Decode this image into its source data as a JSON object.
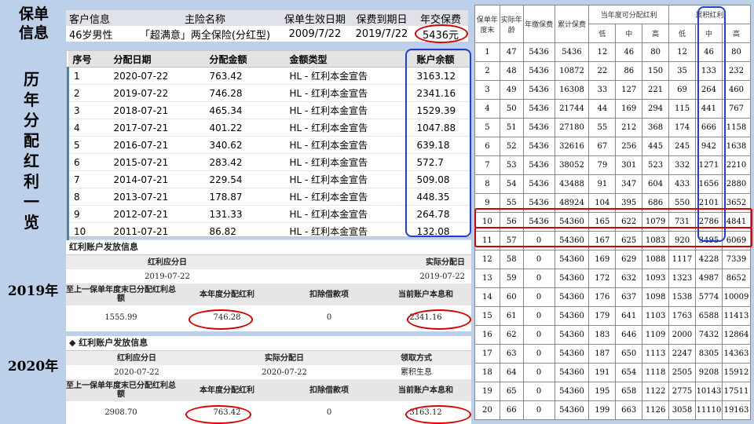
{
  "labels": {
    "policy_info": "保单信息",
    "history": "历年分配红利一览",
    "year_2019": "2019年",
    "year_2020": "2020年"
  },
  "policy": {
    "headers": [
      "客户信息",
      "主险名称",
      "保单生效日期",
      "保费到期日",
      "年交保费"
    ],
    "values": [
      "46岁男性",
      "「超满意」两全保险(分红型)",
      "2009/7/22",
      "2019/7/22",
      "5436元"
    ]
  },
  "history": {
    "headers": [
      "序号",
      "分配日期",
      "分配金额",
      "金额类型",
      "账户余额"
    ],
    "rows": [
      [
        "1",
        "2020-07-22",
        "763.42",
        "HL - 红利本金宣告",
        "3163.12"
      ],
      [
        "2",
        "2019-07-22",
        "746.28",
        "HL - 红利本金宣告",
        "2341.16"
      ],
      [
        "3",
        "2018-07-21",
        "465.34",
        "HL - 红利本金宣告",
        "1529.39"
      ],
      [
        "4",
        "2017-07-21",
        "401.22",
        "HL - 红利本金宣告",
        "1047.88"
      ],
      [
        "5",
        "2016-07-21",
        "340.62",
        "HL - 红利本金宣告",
        "639.18"
      ],
      [
        "6",
        "2015-07-21",
        "283.42",
        "HL - 红利本金宣告",
        "572.7"
      ],
      [
        "7",
        "2014-07-21",
        "229.54",
        "HL - 红利本金宣告",
        "509.08"
      ],
      [
        "8",
        "2013-07-21",
        "178.87",
        "HL - 红利本金宣告",
        "448.35"
      ],
      [
        "9",
        "2012-07-21",
        "131.33",
        "HL - 红利本金宣告",
        "264.78"
      ],
      [
        "10",
        "2011-07-21",
        "86.82",
        "HL - 红利本金宣告",
        "132.08"
      ]
    ]
  },
  "p2019": {
    "title": "红利账户发放信息",
    "h1": [
      "红利应分日",
      "实际分配日"
    ],
    "v1": [
      "2019-07-22",
      "2019-07-22"
    ],
    "h2": [
      "至上一保单年度末已分配红利总额",
      "本年度分配红利",
      "扣除借款项",
      "当前账户本息和"
    ],
    "v2": [
      "1555.99",
      "746.28",
      "0",
      "2341.16"
    ]
  },
  "p2020": {
    "title": "◆ 红利账户发放信息",
    "h1": [
      "红利应分日",
      "实际分配日",
      "领取方式"
    ],
    "v1": [
      "2020-07-22",
      "2020-07-22",
      "累积生息"
    ],
    "h2": [
      "至上一保单年度末已分配红利总额",
      "本年度分配红利",
      "扣除借款项",
      "当前账户本息和"
    ],
    "v2": [
      "2908.70",
      "763.42",
      "0",
      "3163.12"
    ]
  },
  "projection": {
    "head_top": [
      "保单年度末",
      "实际年龄",
      "年缴保费",
      "累计保费",
      "当年度可分配红利",
      "累积红利"
    ],
    "head_sub": [
      "低",
      "中",
      "高",
      "低",
      "中",
      "高"
    ],
    "rows": [
      [
        "1",
        "47",
        "5436",
        "5436",
        "12",
        "46",
        "80",
        "12",
        "46",
        "80"
      ],
      [
        "2",
        "48",
        "5436",
        "10872",
        "22",
        "86",
        "150",
        "35",
        "133",
        "232"
      ],
      [
        "3",
        "49",
        "5436",
        "16308",
        "33",
        "127",
        "221",
        "69",
        "264",
        "460"
      ],
      [
        "4",
        "50",
        "5436",
        "21744",
        "44",
        "169",
        "294",
        "115",
        "441",
        "767"
      ],
      [
        "5",
        "51",
        "5436",
        "27180",
        "55",
        "212",
        "368",
        "174",
        "666",
        "1158"
      ],
      [
        "6",
        "52",
        "5436",
        "32616",
        "67",
        "256",
        "445",
        "245",
        "942",
        "1638"
      ],
      [
        "7",
        "53",
        "5436",
        "38052",
        "79",
        "301",
        "523",
        "332",
        "1271",
        "2210"
      ],
      [
        "8",
        "54",
        "5436",
        "43488",
        "91",
        "347",
        "604",
        "433",
        "1656",
        "2880"
      ],
      [
        "9",
        "55",
        "5436",
        "48924",
        "104",
        "395",
        "686",
        "550",
        "2101",
        "3652"
      ],
      [
        "10",
        "56",
        "5436",
        "54360",
        "165",
        "622",
        "1079",
        "731",
        "2786",
        "4841"
      ],
      [
        "11",
        "57",
        "0",
        "54360",
        "167",
        "625",
        "1083",
        "920",
        "3495",
        "6069"
      ],
      [
        "12",
        "58",
        "0",
        "54360",
        "169",
        "629",
        "1088",
        "1117",
        "4228",
        "7339"
      ],
      [
        "13",
        "59",
        "0",
        "54360",
        "172",
        "632",
        "1093",
        "1323",
        "4987",
        "8652"
      ],
      [
        "14",
        "60",
        "0",
        "54360",
        "176",
        "637",
        "1098",
        "1538",
        "5774",
        "10009"
      ],
      [
        "15",
        "61",
        "0",
        "54360",
        "179",
        "641",
        "1103",
        "1763",
        "6588",
        "11413"
      ],
      [
        "16",
        "62",
        "0",
        "54360",
        "183",
        "646",
        "1109",
        "2000",
        "7432",
        "12864"
      ],
      [
        "17",
        "63",
        "0",
        "54360",
        "187",
        "650",
        "1113",
        "2247",
        "8305",
        "14363"
      ],
      [
        "18",
        "64",
        "0",
        "54360",
        "191",
        "654",
        "1118",
        "2505",
        "9208",
        "15912"
      ],
      [
        "19",
        "65",
        "0",
        "54360",
        "195",
        "658",
        "1122",
        "2775",
        "10143",
        "17511"
      ],
      [
        "20",
        "66",
        "0",
        "54360",
        "199",
        "663",
        "1126",
        "3058",
        "11110",
        "19163"
      ]
    ]
  },
  "colors": {
    "red_highlight": "#d50000",
    "blue_highlight": "#1e3fd3",
    "row_marker": "#3b86c9"
  }
}
